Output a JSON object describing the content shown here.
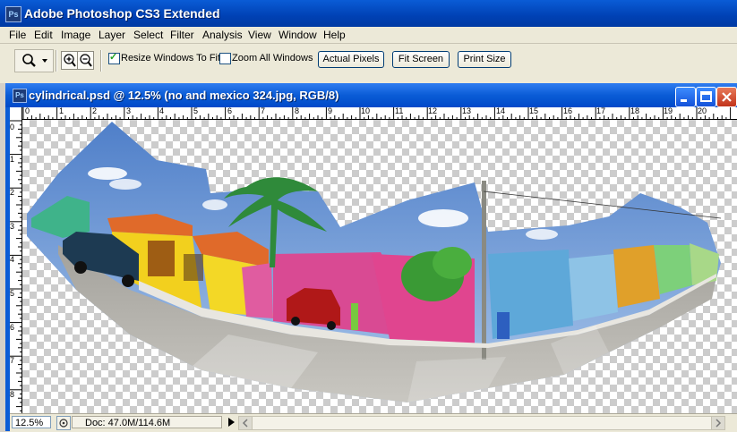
{
  "app": {
    "title": "Adobe Photoshop CS3 Extended",
    "logo": "Ps"
  },
  "menu": [
    "File",
    "Edit",
    "Image",
    "Layer",
    "Select",
    "Filter",
    "Analysis",
    "View",
    "Window",
    "Help"
  ],
  "options": {
    "resize_windows_label": "Resize Windows To Fit",
    "resize_windows_checked": true,
    "zoom_all_label": "Zoom All Windows",
    "zoom_all_checked": false,
    "actual_pixels": "Actual Pixels",
    "fit_screen": "Fit Screen",
    "print_size": "Print Size"
  },
  "document": {
    "title": "cylindrical.psd @ 12.5% (no and mexico 324.jpg, RGB/8)",
    "logo": "Ps"
  },
  "ruler": {
    "horizontal": [
      "0",
      "1",
      "2",
      "3",
      "4",
      "5",
      "6",
      "7",
      "8",
      "9",
      "10",
      "11",
      "12",
      "13",
      "14",
      "15",
      "16",
      "17",
      "18",
      "19",
      "20"
    ],
    "vertical": [
      "0",
      "1",
      "2",
      "3",
      "4",
      "5",
      "6",
      "7",
      "8"
    ]
  },
  "status": {
    "zoom": "12.5%",
    "doc_info": "Doc: 47.0M/114.6M"
  },
  "colors": {
    "title_blue": "#0a5cd6",
    "sky": "#6f9ed8",
    "pink_wall": "#e0458f",
    "yellow_wall": "#f2d01e",
    "orange_roof": "#e06a2a",
    "blue_house": "#5ea8d9",
    "road": "#9c9a94",
    "palm": "#2f8a3a"
  }
}
